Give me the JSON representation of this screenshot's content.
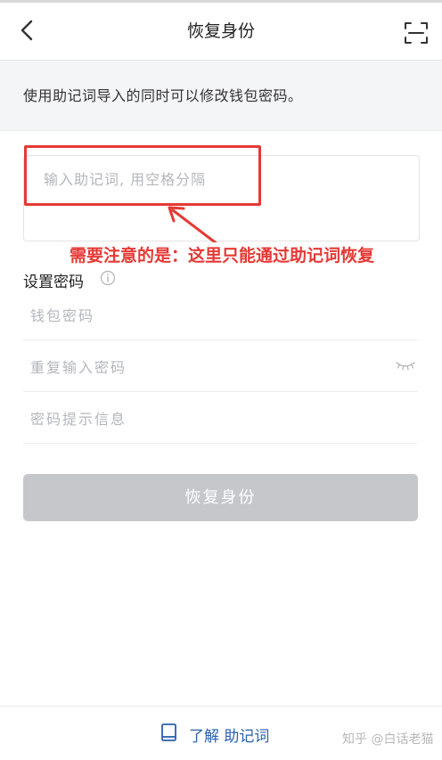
{
  "header": {
    "title": "恢复身份"
  },
  "info": {
    "text": "使用助记词导入的同时可以修改钱包密码。"
  },
  "mnemonic": {
    "placeholder": "输入助记词, 用空格分隔",
    "value": ""
  },
  "annotation": {
    "note": "需要注意的是：这里只能通过助记词恢复",
    "color": "#e53935"
  },
  "password_section": {
    "label": "设置密码",
    "fields": [
      {
        "placeholder": "钱包密码",
        "value": ""
      },
      {
        "placeholder": "重复输入密码",
        "value": ""
      },
      {
        "placeholder": "密码提示信息",
        "value": ""
      }
    ]
  },
  "restore_button": {
    "label": "恢复身份",
    "state": "disabled"
  },
  "footer": {
    "learn_prefix": "了解",
    "learn_link": "助记词",
    "watermark": "知乎 @白话老猫"
  },
  "icons": {
    "back": "chevron-left-icon",
    "scan": "scan-icon",
    "info": "info-circle-icon",
    "eye": "eye-closed-icon",
    "book": "book-icon"
  },
  "colors": {
    "accent": "#2a5fb0",
    "button_disabled": "#c5c7cb",
    "annotation": "#e53935"
  }
}
